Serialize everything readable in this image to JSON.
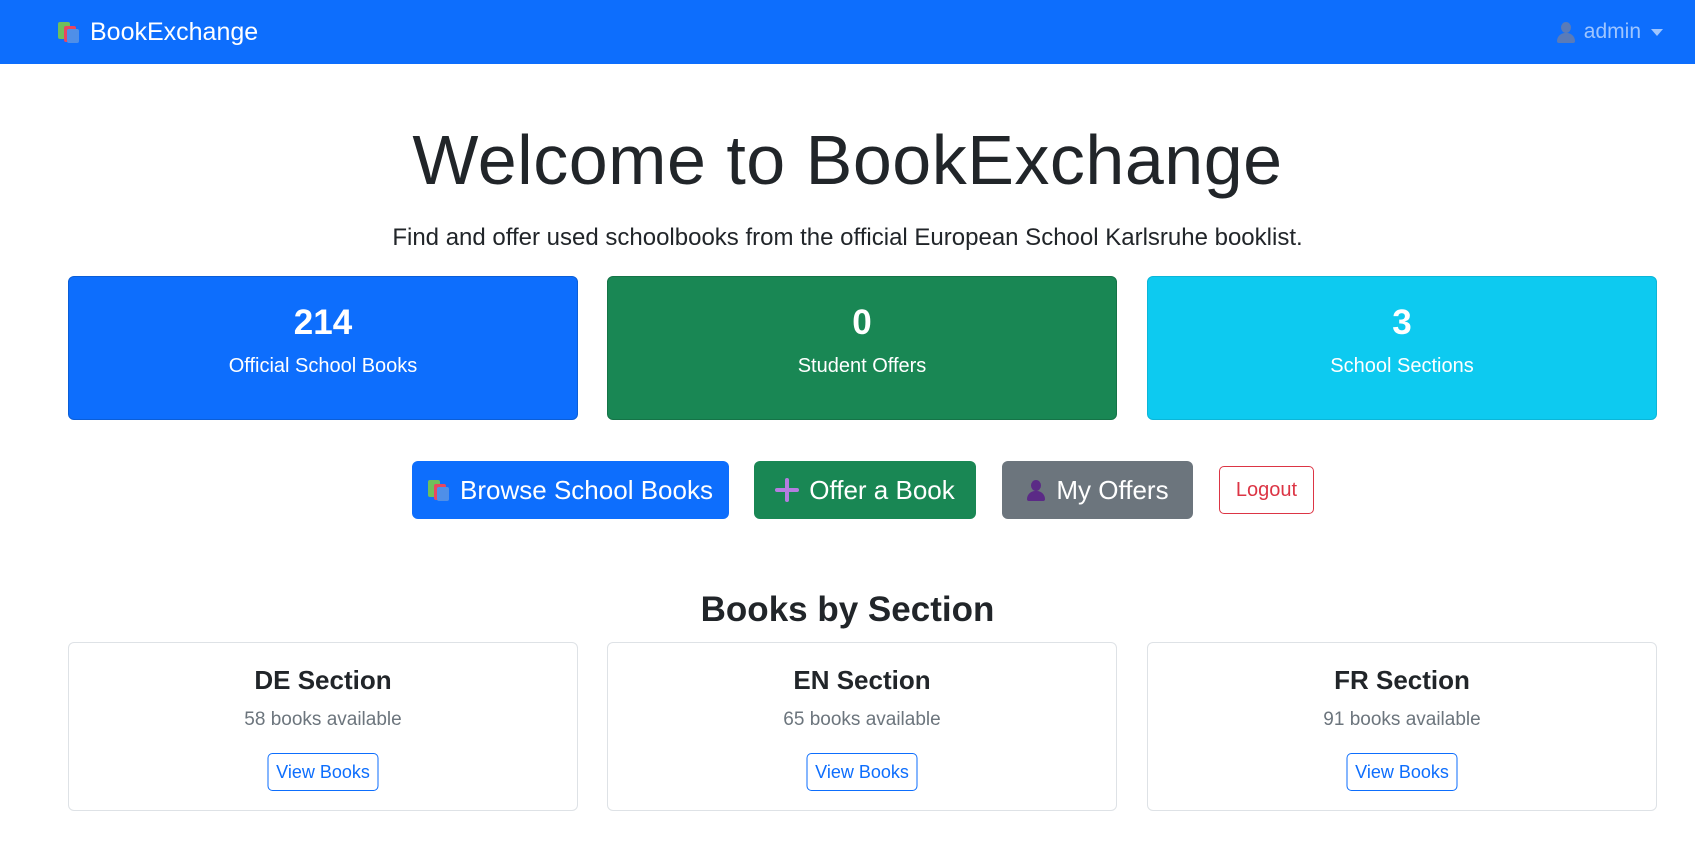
{
  "navbar": {
    "brand": "BookExchange",
    "user": "admin"
  },
  "hero": {
    "title": "Welcome to BookExchange",
    "subtitle": "Find and offer used schoolbooks from the official European School Karlsruhe booklist."
  },
  "stats": [
    {
      "value": "214",
      "label": "Official School Books"
    },
    {
      "value": "0",
      "label": "Student Offers"
    },
    {
      "value": "3",
      "label": "School Sections"
    }
  ],
  "actions": {
    "browse": "Browse School Books",
    "offer": "Offer a Book",
    "my_offers": "My Offers",
    "logout": "Logout"
  },
  "sections_title": "Books by Section",
  "sections": [
    {
      "name": "DE Section",
      "count": "58 books available",
      "button": "View Books"
    },
    {
      "name": "EN Section",
      "count": "65 books available",
      "button": "View Books"
    },
    {
      "name": "FR Section",
      "count": "91 books available",
      "button": "View Books"
    }
  ],
  "colors": {
    "primary": "#0d6efd",
    "success": "#198754",
    "info": "#0dcaf0",
    "secondary": "#6c757d",
    "danger": "#dc3545"
  }
}
